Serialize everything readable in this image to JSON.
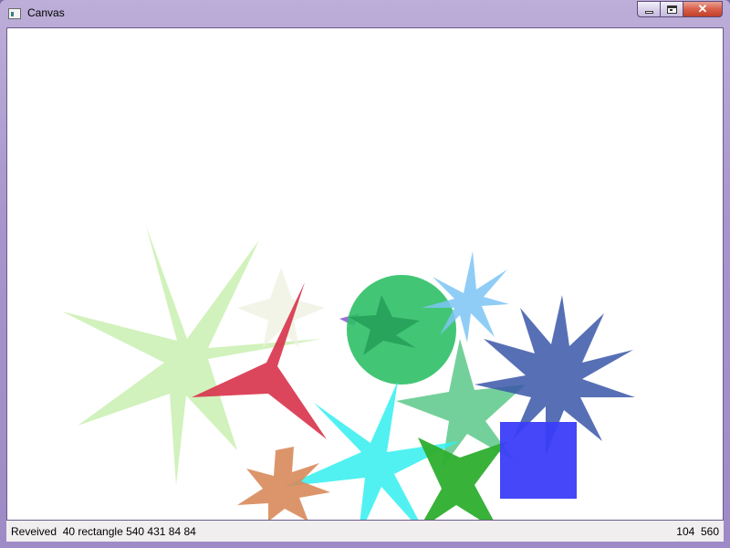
{
  "window": {
    "title": "Canvas",
    "app_icon": "window-app-icon",
    "controls": {
      "minimize_icon": "minimize-icon",
      "maximize_icon": "maximize-icon",
      "close_label": "✕"
    }
  },
  "canvas": {
    "background": "#ffffff",
    "shapes": [
      {
        "kind": "star",
        "name": "light-green-star-shape",
        "color": "#c9f0b0"
      },
      {
        "kind": "star",
        "name": "pale-beige-star-shape",
        "color": "#eef0e0"
      },
      {
        "kind": "star",
        "name": "red-three-point-star-shape",
        "color": "#d8324a"
      },
      {
        "kind": "circle",
        "name": "green-circle-shape",
        "color": "#2ec066"
      },
      {
        "kind": "star",
        "name": "dark-green-star-shape",
        "color": "#27a05a"
      },
      {
        "kind": "star",
        "name": "light-blue-star-shape",
        "color": "#7cc4f4"
      },
      {
        "kind": "star",
        "name": "medium-green-star-shape",
        "color": "#5cc888"
      },
      {
        "kind": "star",
        "name": "navy-blue-star-shape",
        "color": "#3a56a8"
      },
      {
        "kind": "star",
        "name": "cyan-star-shape",
        "color": "#33eef0"
      },
      {
        "kind": "star",
        "name": "orange-star-shape",
        "color": "#d88a5a"
      },
      {
        "kind": "star",
        "name": "green-four-point-star-shape",
        "color": "#2eae2e"
      },
      {
        "kind": "rectangle",
        "name": "blue-square-shape",
        "color": "#3b3df8"
      }
    ]
  },
  "status": {
    "message": "Reveived  40 rectangle 540 431 84 84",
    "coordinates": "104  560"
  }
}
